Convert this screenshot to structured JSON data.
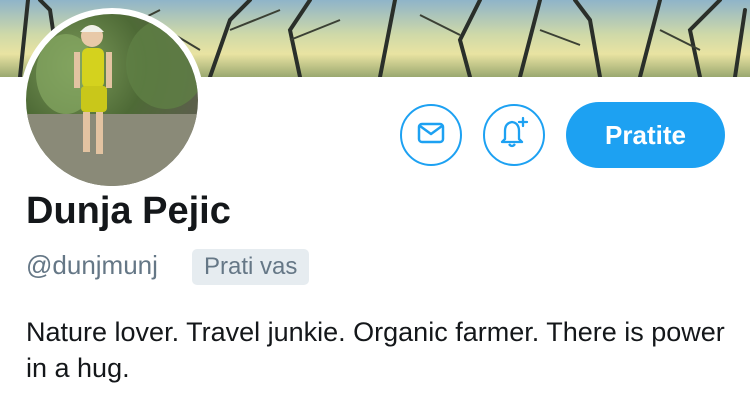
{
  "profile": {
    "display_name": "Dunja Pejic",
    "handle": "@dunjmunj",
    "follows_you_badge": "Prati vas",
    "bio": "Nature lover. Travel junkie. Organic farmer. There is power in a hug."
  },
  "actions": {
    "message_icon": "envelope-icon",
    "notify_icon": "bell-plus-icon",
    "follow_label": "Pratite"
  },
  "colors": {
    "accent": "#1da1f2",
    "badge_bg": "#e6ecf0",
    "secondary_text": "#657786",
    "primary_text": "#14171a"
  }
}
